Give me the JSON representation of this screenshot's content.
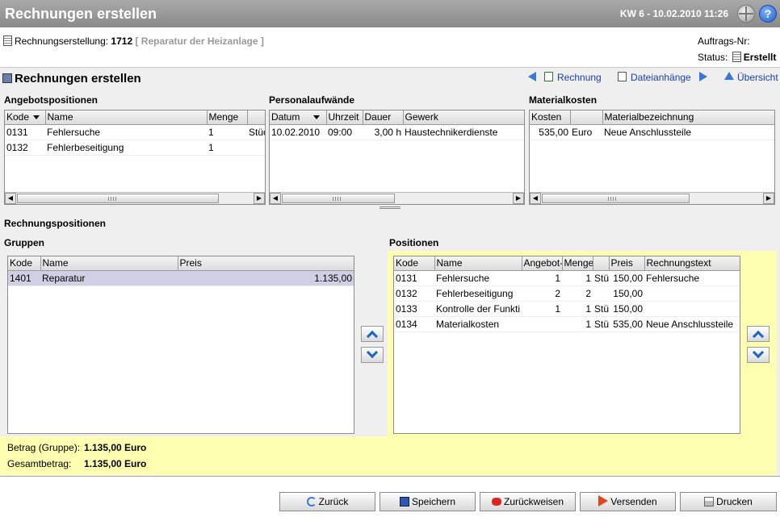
{
  "header": {
    "title": "Rechnungen erstellen",
    "datetime": "KW 6 - 10.02.2010 11:26",
    "globe_icon": "globe-icon",
    "help_icon": "help-icon",
    "help_glyph": "?"
  },
  "info": {
    "label": "Rechnungserstellung:",
    "number": "1712",
    "description": "[ Reparatur der Heizanlage ]",
    "order_label": "Auftrags-Nr:",
    "status_label": "Status:",
    "status_value": "Erstellt"
  },
  "section": {
    "title": "Rechnungen erstellen",
    "links": {
      "invoice": "Rechnung",
      "attachments": "Dateianhänge",
      "overview": "Übersicht"
    }
  },
  "angebot": {
    "title": "Angebotspositionen",
    "columns": [
      "Kode",
      "Name",
      "Menge",
      ""
    ],
    "rows": [
      [
        "0131",
        "Fehlersuche",
        "1",
        "Stück"
      ],
      [
        "0132",
        "Fehlerbeseitigung",
        "1",
        ""
      ]
    ]
  },
  "personal": {
    "title": "Personalaufwände",
    "columns": [
      "Datum",
      "Uhrzeit",
      "Dauer",
      "Gewerk"
    ],
    "rows": [
      [
        "10.02.2010",
        "09:00",
        "3,00 h",
        "Haustechnikerdienste"
      ]
    ]
  },
  "material": {
    "title": "Materialkosten",
    "columns": [
      "Kosten",
      "",
      "Materialbezeichnung"
    ],
    "rows": [
      [
        "535,00",
        "Euro",
        "Neue Anschlussteile"
      ]
    ]
  },
  "rechnungspositionen": {
    "title": "Rechnungspositionen"
  },
  "gruppen": {
    "title": "Gruppen",
    "columns": [
      "Kode",
      "Name",
      "Preis"
    ],
    "rows": [
      [
        "1401",
        "Reparatur",
        "1.135,00"
      ]
    ]
  },
  "positionen": {
    "title": "Positionen",
    "columns": [
      "Kode",
      "Name",
      "Angebot-",
      "Menge",
      "",
      "Preis",
      "Rechnungstext"
    ],
    "rows": [
      [
        "0131",
        "Fehlersuche",
        "1",
        "1",
        "Stü",
        "150,00",
        "Fehlersuche"
      ],
      [
        "0132",
        "Fehlerbeseitigung",
        "2",
        "2",
        "",
        "150,00",
        ""
      ],
      [
        "0133",
        "Kontrolle der Funkti",
        "1",
        "1",
        "Stü",
        "150,00",
        ""
      ],
      [
        "0134",
        "Materialkosten",
        "",
        "1",
        "Stü",
        "535,00",
        "Neue Anschlussteile"
      ]
    ]
  },
  "totals": {
    "group_label": "Betrag (Gruppe):",
    "group_value": "1.135,00 Euro",
    "total_label": "Gesamtbetrag:",
    "total_value": "1.135,00 Euro"
  },
  "buttons": {
    "back": "Zurück",
    "save": "Speichern",
    "reject": "Zurückweisen",
    "send": "Versenden",
    "print": "Drucken"
  },
  "colors": {
    "titlebar": "#8f8f8f",
    "highlight": "#ffffb2",
    "selected_row": "#cfd0e4",
    "link": "#1a3fb5"
  }
}
